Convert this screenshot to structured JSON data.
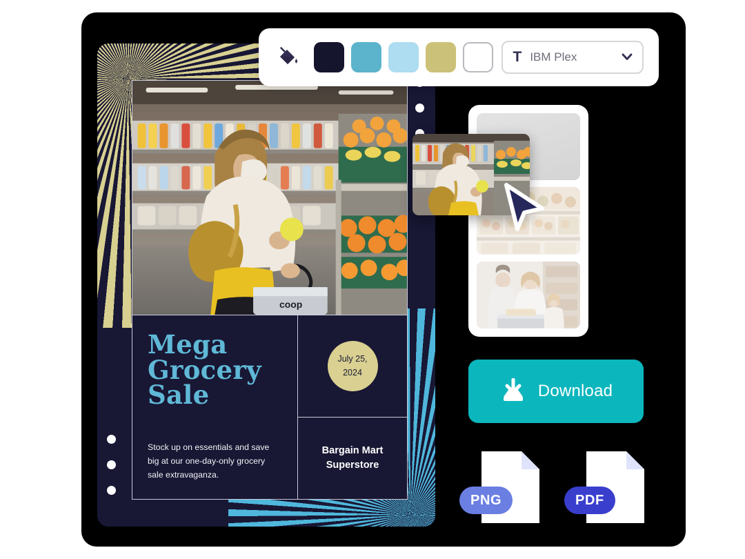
{
  "app": {
    "backdrop_color": "#000000",
    "page_background": "#ffffff"
  },
  "toolbar": {
    "paint_bucket_icon": "paint-bucket-icon",
    "swatches": [
      {
        "name": "dark-navy",
        "hex": "#16152E",
        "selected": true
      },
      {
        "name": "teal-blue",
        "hex": "#5BB4CC",
        "selected": false
      },
      {
        "name": "light-blue",
        "hex": "#AEDCF0",
        "selected": false
      },
      {
        "name": "khaki-gold",
        "hex": "#CCC178",
        "selected": false
      },
      {
        "name": "white",
        "hex": "#FFFFFF",
        "selected": false
      }
    ],
    "font_select": {
      "glyph": "T",
      "value": "IBM Plex",
      "chevron": "chevron-down-icon"
    }
  },
  "poster": {
    "title": "Mega Grocery Sale",
    "title_lines": [
      "Mega",
      "Grocery",
      "Sale"
    ],
    "body": "Stock up on essentials and save big at our one-day-only grocery sale extravaganza.",
    "date": "July 25, 2024",
    "date_lines": [
      "July 25,",
      "2024"
    ],
    "brand_lines": [
      "Bargain Mart",
      "Superstore"
    ],
    "colors": {
      "background": "#181734",
      "title": "#5FB8D6",
      "date_circle": "#D9D091",
      "sunburst_gold": "#D8D091",
      "sunburst_cyan": "#4FB7DB",
      "frame_border": "#C9CAD8"
    },
    "hero_image_alt": "Woman in face mask holding a lemon while shopping in a supermarket produce aisle",
    "handles_left": [
      "handle",
      "handle",
      "handle"
    ],
    "handles_right": [
      "handle",
      "handle",
      "handle"
    ]
  },
  "thumbnails": {
    "slots": [
      {
        "name": "thumbnail-slot-empty",
        "state": "empty",
        "alt": ""
      },
      {
        "name": "thumbnail-slot-produce",
        "state": "filled",
        "alt": "Fruit and vegetable market stall"
      },
      {
        "name": "thumbnail-slot-family",
        "state": "filled",
        "alt": "Family shopping together in a grocery store"
      }
    ],
    "dragged_image_alt": "Woman shopping in supermarket aisle",
    "cursor": "cursor-arrow-icon"
  },
  "actions": {
    "download": {
      "label": "Download",
      "icon": "download-icon",
      "color": "#0CB6BD"
    },
    "formats": [
      {
        "label": "PNG",
        "badge_color": "#6B7EE2",
        "icon": "file-icon"
      },
      {
        "label": "PDF",
        "badge_color": "#3A3ECD",
        "icon": "file-icon"
      }
    ]
  }
}
